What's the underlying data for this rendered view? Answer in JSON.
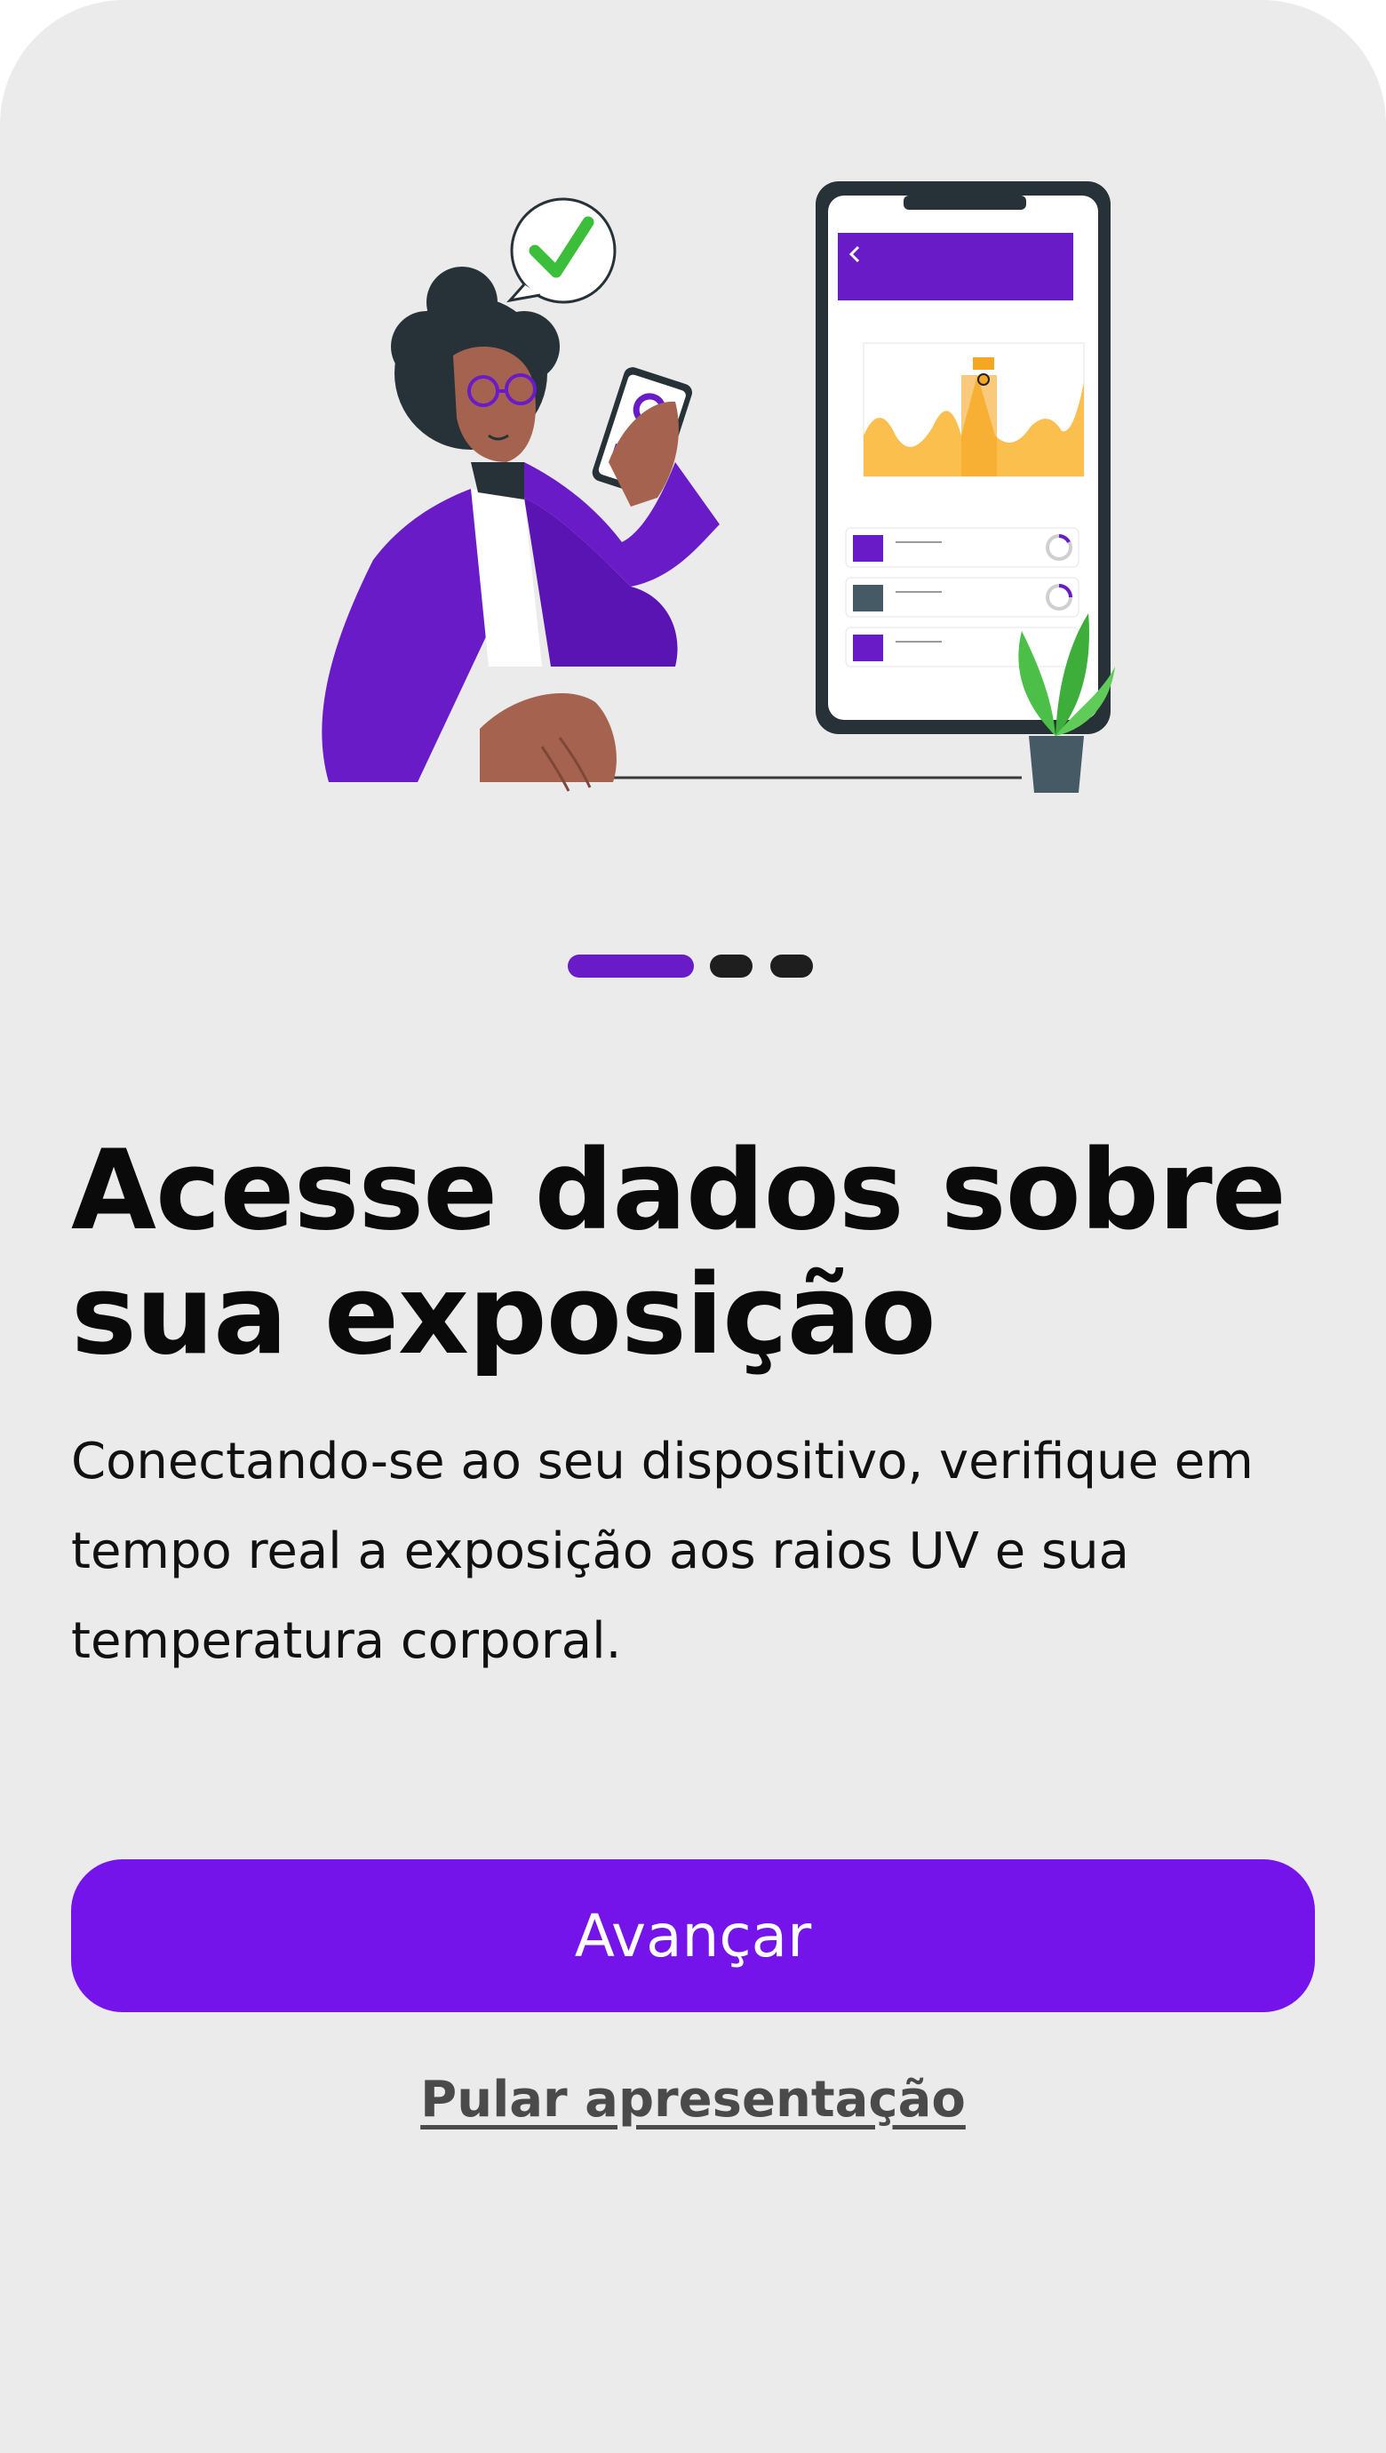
{
  "onboarding": {
    "title": "Acesse dados sobre sua exposição",
    "description": "Conectando-se ao seu dispositivo, verifique em tempo real a exposição aos raios UV e sua temperatura corporal.",
    "pager": {
      "total_pages": 3,
      "current_page": 1
    },
    "primary_action_label": "Avançar",
    "skip_label": "Pular apresentação"
  },
  "illustration": {
    "subject": "person-holding-phone-with-health-dashboard",
    "icons": [
      "checkmark-icon",
      "plant-icon"
    ]
  },
  "colors": {
    "background": "#ECEBEC",
    "accent": "#7513EB",
    "pager_active": "#6A1BC8",
    "pager_inactive": "#1E1E1E",
    "chart_fill": "#FBBF4E",
    "check_green": "#3DBE3A"
  }
}
